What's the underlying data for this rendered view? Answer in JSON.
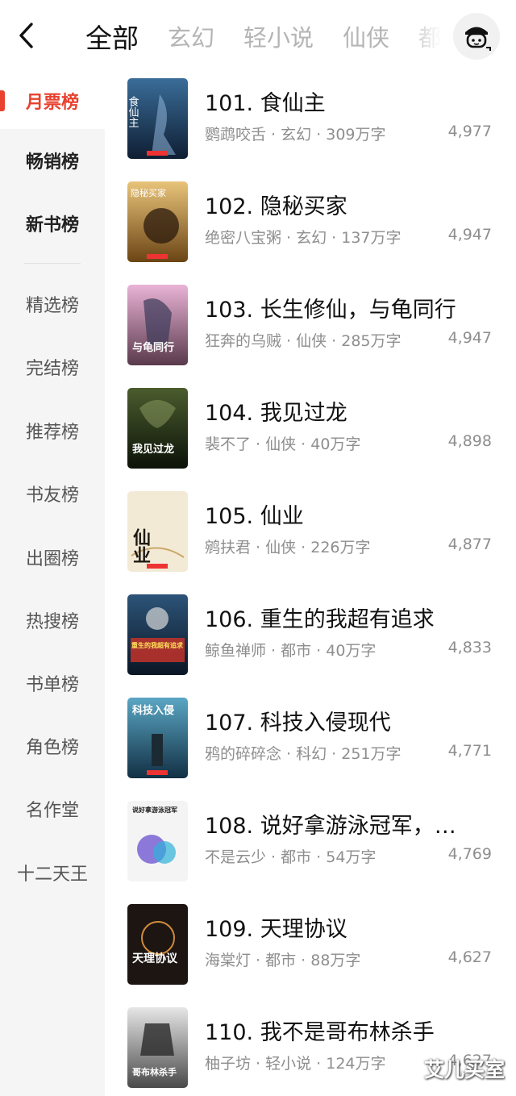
{
  "header": {
    "tabs": [
      "全部",
      "玄幻",
      "轻小说",
      "仙侠",
      "都市"
    ],
    "active_tab": "全部"
  },
  "sidebar": {
    "items": [
      {
        "label": "月票榜"
      },
      {
        "label": "畅销榜"
      },
      {
        "label": "新书榜"
      },
      {
        "label": "精选榜"
      },
      {
        "label": "完结榜"
      },
      {
        "label": "推荐榜"
      },
      {
        "label": "书友榜"
      },
      {
        "label": "出圈榜"
      },
      {
        "label": "热搜榜"
      },
      {
        "label": "书单榜"
      },
      {
        "label": "角色榜"
      },
      {
        "label": "名作堂"
      },
      {
        "label": "十二天王"
      }
    ]
  },
  "books": [
    {
      "title": "101. 食仙主",
      "meta": "鹦鹉咬舌 · 玄幻 · 309万字",
      "count": "4,977",
      "cover_text": "食仙主",
      "cover_color": "#1d3b5e"
    },
    {
      "title": "102. 隐秘买家",
      "meta": "绝密八宝粥 · 玄幻 · 137万字",
      "count": "4,947",
      "cover_text": "隐秘买家",
      "cover_color": "#b88a3c"
    },
    {
      "title": "103. 长生修仙，与龟同行",
      "meta": "狂奔的乌贼 · 仙侠 · 285万字",
      "count": "4,947",
      "cover_text": "与龟同行",
      "cover_color": "#8a5a8c"
    },
    {
      "title": "104. 我见过龙",
      "meta": "裴不了 · 仙侠 · 40万字",
      "count": "4,898",
      "cover_text": "我见过龙",
      "cover_color": "#27361d"
    },
    {
      "title": "105. 仙业",
      "meta": "鹓扶君 · 仙侠 · 226万字",
      "count": "4,877",
      "cover_text": "仙业",
      "cover_color": "#efe6d2"
    },
    {
      "title": "106. 重生的我超有追求",
      "meta": "鲸鱼禅师 · 都市 · 40万字",
      "count": "4,833",
      "cover_text": "重生的我超有追求",
      "cover_color": "#17324f"
    },
    {
      "title": "107. 科技入侵现代",
      "meta": "鸦的碎碎念 · 科幻 · 251万字",
      "count": "4,771",
      "cover_text": "科技入侵",
      "cover_color": "#2d6f8a"
    },
    {
      "title": "108. 说好拿游泳冠军，…",
      "meta": "不是云少 · 都市 · 54万字",
      "count": "4,769",
      "cover_text": "说好拿游泳冠军",
      "cover_color": "#3a2a6e"
    },
    {
      "title": "109. 天理协议",
      "meta": "海棠灯 · 都市 · 88万字",
      "count": "4,627",
      "cover_text": "天理协议",
      "cover_color": "#2a2320"
    },
    {
      "title": "110. 我不是哥布林杀手",
      "meta": "柚子坊 · 轻小说 · 124万字",
      "count": "4,627",
      "cover_text": "哥布林杀手",
      "cover_color": "#6b6b6b"
    }
  ],
  "watermark": "艾儿买室",
  "colors": {
    "accent": "#e8412f",
    "sidebar_bg": "#f5f5f5"
  }
}
